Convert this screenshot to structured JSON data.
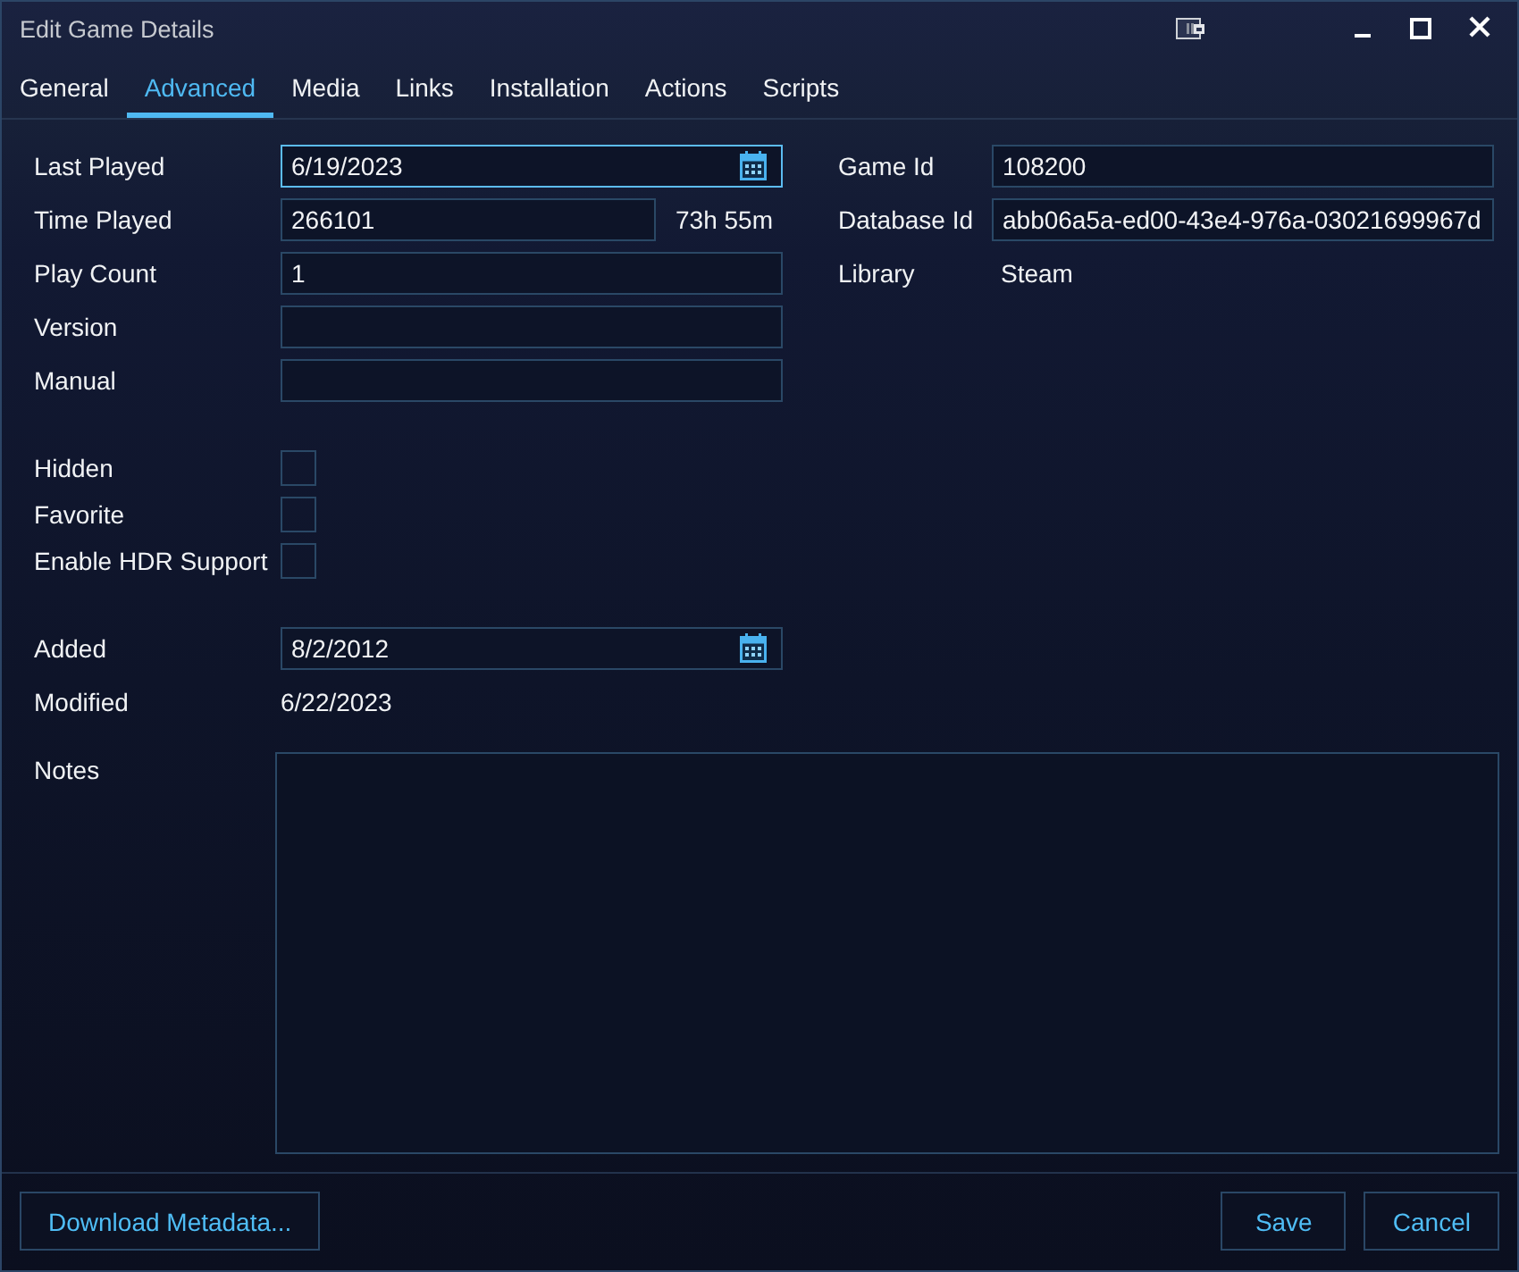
{
  "window": {
    "title": "Edit Game Details"
  },
  "tabs": [
    {
      "label": "General",
      "selected": false
    },
    {
      "label": "Advanced",
      "selected": true
    },
    {
      "label": "Media",
      "selected": false
    },
    {
      "label": "Links",
      "selected": false
    },
    {
      "label": "Installation",
      "selected": false
    },
    {
      "label": "Actions",
      "selected": false
    },
    {
      "label": "Scripts",
      "selected": false
    }
  ],
  "details": {
    "groups": [
      {
        "rows": [
          {
            "kind": "date",
            "label": "Last Played",
            "value": "6/19/2023",
            "focused": true
          },
          {
            "kind": "text",
            "label": "Time Played",
            "value": "266101",
            "focused": false,
            "reading": "73h 55m"
          },
          {
            "kind": "text",
            "label": "Play Count",
            "value": "1",
            "focused": false
          },
          {
            "kind": "text",
            "label": "Version",
            "focused": false
          },
          {
            "kind": "text",
            "label": "Manual",
            "focused": false
          }
        ]
      },
      {
        "rows": [
          {
            "kind": "checkbox",
            "label": "Hidden",
            "checked": false
          },
          {
            "kind": "checkbox",
            "label": "Favorite",
            "checked": false
          },
          {
            "kind": "checkbox",
            "label": "Enable HDR Support",
            "checked": false
          }
        ]
      },
      {
        "rows": [
          {
            "kind": "date",
            "label": "Added",
            "value": "8/2/2012",
            "focused": false
          },
          {
            "kind": "static",
            "label": "Modified",
            "value": "6/22/2023"
          }
        ]
      }
    ]
  },
  "ids": {
    "rows": [
      {
        "kind": "text",
        "label": "Game Id",
        "value": "108200",
        "focused": false
      },
      {
        "kind": "text",
        "label": "Database Id",
        "value": "abb06a5a-ed00-43e4-976a-03021699967d",
        "focused": false
      },
      {
        "kind": "static",
        "label": "Library",
        "value": "Steam"
      }
    ]
  },
  "notes": {
    "label": "Notes"
  },
  "footer": {
    "left_buttons": [
      {
        "label": "Download Metadata..."
      }
    ],
    "right_buttons": [
      {
        "label": "Save"
      },
      {
        "label": "Cancel"
      }
    ]
  }
}
